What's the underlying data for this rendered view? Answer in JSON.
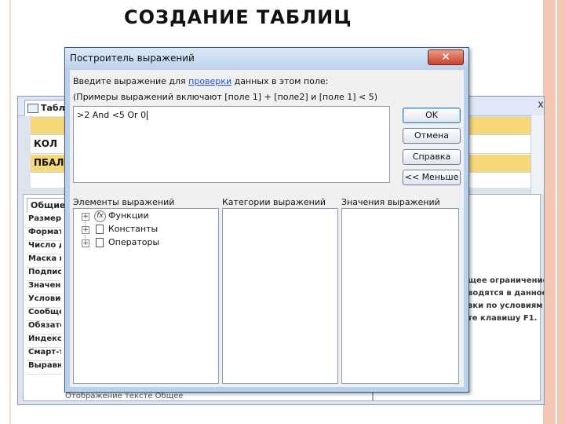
{
  "slide": {
    "title": "СОЗДАНИЕ ТАБЛИЦ"
  },
  "background_window": {
    "tab_label": "Таблиц",
    "close_glyph": "x",
    "grid_rows": [
      "",
      "КОЛ",
      "ПБАЛЛ"
    ],
    "props_tab": "Общие",
    "props_rows": [
      "Размер по",
      "Формат по",
      "Число дес",
      "Маска вво",
      "Подпись",
      "Значение",
      "Условие на",
      "Сообщени",
      "Обязатель",
      "Индексиро",
      "Смарт-тег",
      "Выравнив"
    ],
    "help_lines": [
      "щее ограничение",
      "водятся в данное",
      "вки по условиям",
      "те клавишу F1."
    ],
    "footer_text": "Отображение тексте           Общее"
  },
  "dialog": {
    "title": "Построитель выражений",
    "close_glyph": "✕",
    "instruction_prefix": "Введите выражение для ",
    "instruction_link": "проверки",
    "instruction_suffix": " данных в этом поле:",
    "examples": "(Примеры выражений включают  [поле 1]  + [поле2] и  [поле 1]  < 5)",
    "expression": ">2 And <5 Or 0",
    "buttons": {
      "ok": "OK",
      "cancel": "Отмена",
      "help": "Справка",
      "less": "<< Меньше"
    },
    "panes": {
      "elements_label": "Элементы выражений",
      "categories_label": "Категории выражений",
      "values_label": "Значения выражений",
      "tree": [
        {
          "label": "Функции",
          "icon": "fx-icon",
          "expander": "+"
        },
        {
          "label": "Константы",
          "icon": "folder-icon",
          "expander": "+"
        },
        {
          "label": "Операторы",
          "icon": "folder-icon",
          "expander": "+"
        }
      ],
      "fx_glyph": "fx"
    }
  }
}
